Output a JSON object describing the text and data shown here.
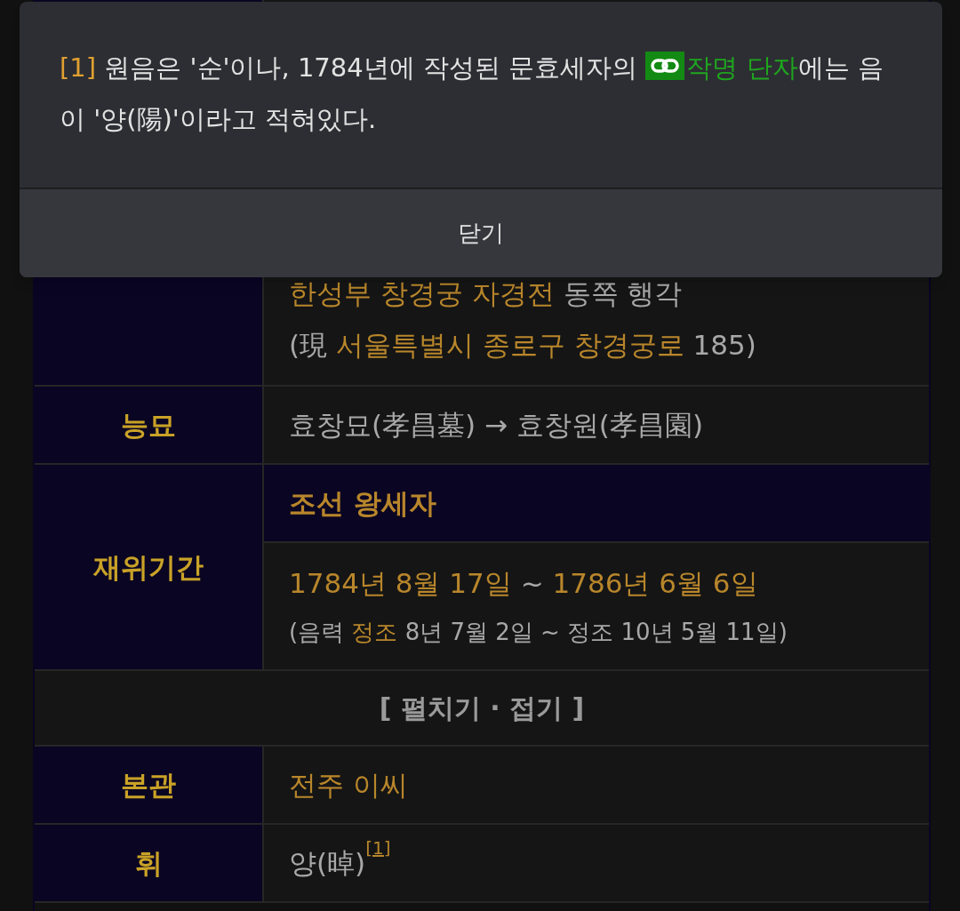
{
  "infobox": {
    "rows": [
      {
        "kind": "field",
        "lines": [
          [
            {
              "text": "한성부 창경궁 자경전",
              "kind": "link"
            },
            {
              "text": " 동쪽 행각",
              "kind": "plain"
            }
          ],
          [
            {
              "text": "(現 ",
              "kind": "plain"
            },
            {
              "text": "서울특별시 종로구 창경궁로",
              "kind": "link"
            },
            {
              "text": " 185)",
              "kind": "plain"
            }
          ]
        ]
      },
      {
        "kind": "field",
        "label": "능묘",
        "lines": [
          [
            {
              "text": "효창묘(孝昌墓) → 효창원(孝昌園)",
              "kind": "plain"
            }
          ]
        ]
      },
      {
        "kind": "section",
        "label": "재위기간",
        "title": "조선 왕세자",
        "lines": [
          [
            {
              "text": "1784년 8월 17일",
              "kind": "link"
            },
            {
              "text": " ~ ",
              "kind": "plain"
            },
            {
              "text": "1786년 6월 6일",
              "kind": "link"
            }
          ],
          [
            {
              "text": "(음력 ",
              "kind": "plain"
            },
            {
              "text": "정조",
              "kind": "link"
            },
            {
              "text": " 8년 7월 2일 ~ 정조 10년 5월 11일)",
              "kind": "plain"
            }
          ]
        ]
      },
      {
        "kind": "toggle",
        "text": "[ 펼치기 · 접기 ]"
      },
      {
        "kind": "field",
        "label": "본관",
        "lines": [
          [
            {
              "text": "전주 이씨",
              "kind": "link"
            }
          ]
        ]
      },
      {
        "kind": "field",
        "label": "휘",
        "lines": [
          [
            {
              "text": "양(晫)",
              "kind": "plain"
            },
            {
              "text": "[1]",
              "kind": "footnote"
            }
          ]
        ]
      }
    ]
  },
  "footnote_popup": {
    "marker": "[1]",
    "segments": [
      {
        "text": " 원음은 '순'이나, 1784년에 작성된 문효세자의 ",
        "kind": "plain"
      },
      {
        "text": "작명 단자",
        "kind": "link"
      },
      {
        "text": "에는 음이 '양(陽)'이라고 적혀있다.",
        "kind": "plain"
      }
    ],
    "close_button": "닫기"
  }
}
